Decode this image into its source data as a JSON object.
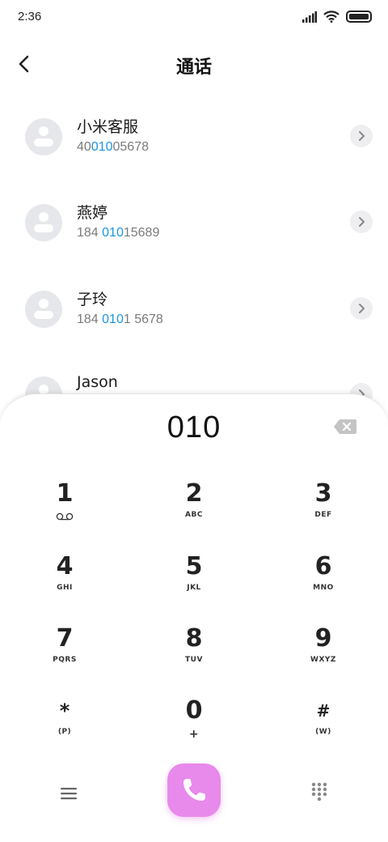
{
  "status_bar": {
    "time": "2:36",
    "icons": [
      "signal-icon",
      "wifi-icon",
      "battery-icon"
    ]
  },
  "header": {
    "title": "通话",
    "back_icon": "back-arrow-icon"
  },
  "contacts": [
    {
      "name": "小米客服",
      "number_parts": [
        "40",
        "010",
        "05678"
      ]
    },
    {
      "name": "燕婷",
      "number_parts": [
        "184 ",
        "010",
        "15689"
      ]
    },
    {
      "name": "子玲",
      "number_parts": [
        "184 ",
        "010",
        "1 5678"
      ]
    },
    {
      "name": "Jason",
      "number_parts": [
        "",
        "",
        ""
      ]
    }
  ],
  "dialer": {
    "input": "010",
    "keys": [
      {
        "digit": "1",
        "letters": ""
      },
      {
        "digit": "2",
        "letters": "ABC"
      },
      {
        "digit": "3",
        "letters": "DEF"
      },
      {
        "digit": "4",
        "letters": "GHI"
      },
      {
        "digit": "5",
        "letters": "JKL"
      },
      {
        "digit": "6",
        "letters": "MNO"
      },
      {
        "digit": "7",
        "letters": "PQRS"
      },
      {
        "digit": "8",
        "letters": "TUV"
      },
      {
        "digit": "9",
        "letters": "WXYZ"
      },
      {
        "digit": "*",
        "letters": "(P)"
      },
      {
        "digit": "0",
        "letters": "+"
      },
      {
        "digit": "#",
        "letters": "(W)"
      }
    ]
  },
  "colors": {
    "highlight": "#1a96e0",
    "call_button": "#e889ec",
    "avatar_bg": "#e6e7ea"
  }
}
